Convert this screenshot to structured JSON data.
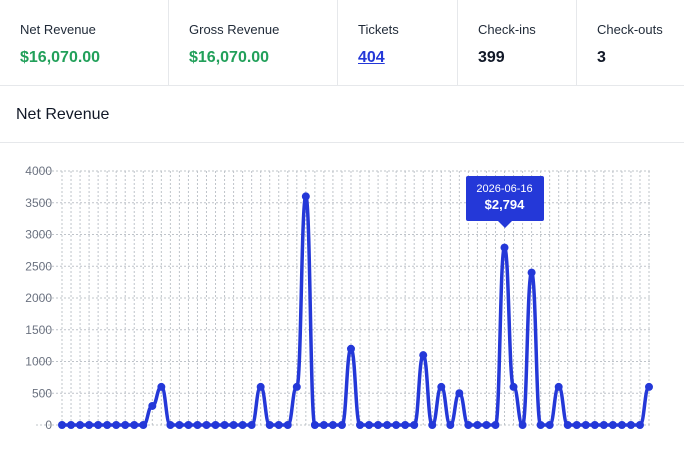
{
  "stats": [
    {
      "label": "Net Revenue",
      "value": "$16,070.00",
      "kind": "money"
    },
    {
      "label": "Gross Revenue",
      "value": "$16,070.00",
      "kind": "money"
    },
    {
      "label": "Tickets",
      "value": "404",
      "kind": "link"
    },
    {
      "label": "Check-ins",
      "value": "399",
      "kind": "plain"
    },
    {
      "label": "Check-outs",
      "value": "3",
      "kind": "plain"
    }
  ],
  "panel": {
    "title": "Net Revenue"
  },
  "colors": {
    "line": "#2438d8",
    "money": "#22a05a",
    "grid": "#bfc4ca"
  },
  "tooltip": {
    "date": "2026-06-16",
    "value": "$2,794"
  },
  "chart_data": {
    "type": "line",
    "series": [
      {
        "values": [
          0,
          0,
          0,
          0,
          0,
          0,
          0,
          0,
          0,
          0,
          300,
          600,
          0,
          0,
          0,
          0,
          0,
          0,
          0,
          0,
          0,
          0,
          600,
          0,
          0,
          0,
          600,
          3600,
          0,
          0,
          0,
          0,
          1200,
          0,
          0,
          0,
          0,
          0,
          0,
          0,
          1100,
          0,
          600,
          0,
          500,
          0,
          0,
          0,
          0,
          2794,
          600,
          0,
          2400,
          0,
          0,
          600,
          0,
          0,
          0,
          0,
          0,
          0,
          0,
          0,
          0,
          600
        ]
      }
    ],
    "highlight_index": 49,
    "ylim": [
      0,
      4000
    ],
    "yticks": [
      0,
      500,
      1000,
      1500,
      2000,
      2500,
      3000,
      3500,
      4000
    ],
    "grid": true,
    "legend": "none"
  }
}
